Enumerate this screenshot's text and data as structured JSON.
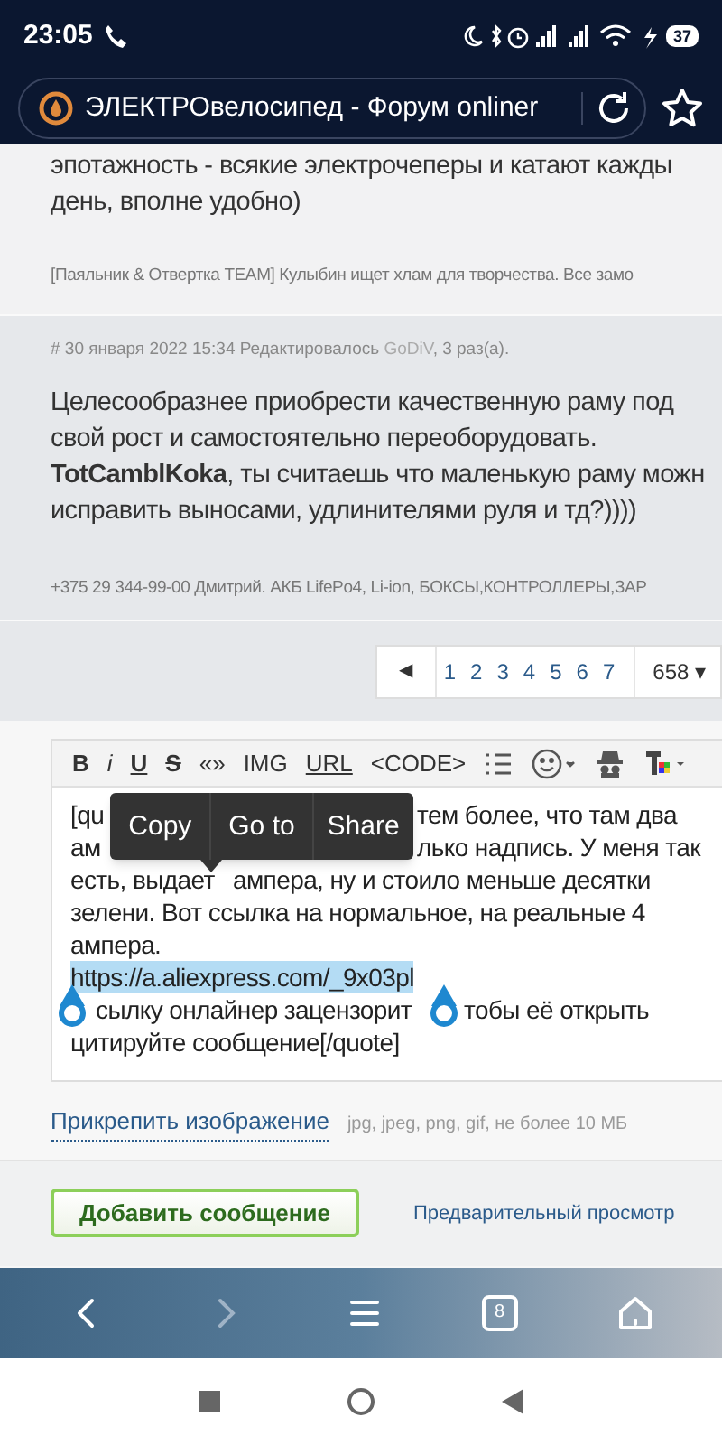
{
  "status_bar": {
    "time": "23:05",
    "battery": "37"
  },
  "address_bar": {
    "title": "ЭЛЕКТРОвелосипед - Форум onliner"
  },
  "previous_post": {
    "text_lines": [
      "эпотажность - всякие электрочеперы и катают кажды",
      "день, вполне удобно)"
    ],
    "signature": "[Паяльник & Отвертка TEAM] Кулыбин ищет хлам для творчества. Все замо"
  },
  "post": {
    "meta_prefix": "# 30 января 2022 15:34 Редактировалось ",
    "editor": "GoDiV",
    "meta_suffix": ", 3 раз(а).",
    "text_lines": [
      "Целесообразнее приобрести качественную раму под",
      "свой рост и самостоятельно переоборудовать.",
      "**TotCamblKoka**, ты считаешь что маленькую раму можн",
      "исправить выносами, удлинителями руля и тд?))))"
    ],
    "signature": "+375 29 344-99-00 Дмитрий. АКБ LifePo4, Li-ion, БОКСЫ,КОНТРОЛЛЕРЫ,ЗАР"
  },
  "pagination": {
    "prev": "◀",
    "pages": [
      "1",
      "2",
      "3",
      "4",
      "5",
      "6",
      "7"
    ],
    "last": "658 ▾"
  },
  "toolbar": [
    {
      "kind": "text",
      "label": "B"
    },
    {
      "kind": "text",
      "label": "i"
    },
    {
      "kind": "text",
      "label": "U"
    },
    {
      "kind": "text",
      "label": "S"
    },
    {
      "kind": "text",
      "label": "«»"
    },
    {
      "kind": "text",
      "label": "IMG"
    },
    {
      "kind": "text",
      "label": "URL"
    },
    {
      "kind": "text",
      "label": "<CODE>"
    },
    {
      "kind": "list"
    },
    {
      "kind": "smiley"
    },
    {
      "kind": "spy"
    },
    {
      "kind": "color"
    }
  ],
  "editor_lines": [
    {
      "parts": [
        "[qu",
        "тем более, что там два"
      ],
      "selected": false
    },
    {
      "parts": [
        "ам",
        "лько надпись. У меня так"
      ],
      "selected": false
    },
    {
      "parts": [
        "есть, выдает",
        "ампера, ну и стоило меньше десятки"
      ],
      "selected": false
    },
    {
      "parts": [
        "зелени.  Вот ссылка на нормальное, на реальные 4"
      ],
      "selected": false
    },
    {
      "parts": [
        "ампера."
      ],
      "selected": false
    },
    {
      "parts": [
        "https://a.aliexpress.com/_9x03pl"
      ],
      "selected": true
    },
    {
      "parts": [
        "сылку онлайнер зацензорит",
        "тобы её открыть"
      ],
      "selected": false
    },
    {
      "parts": [
        "цитируйте сообщение[/quote]"
      ],
      "selected": false
    }
  ],
  "context_menu": [
    "Copy",
    "Go to",
    "Share"
  ],
  "attach": {
    "link": "Прикрепить изображение",
    "hint": "jpg, jpeg, png, gif, не более 10 МБ"
  },
  "actions": {
    "submit": "Добавить сообщение",
    "preview": "Предварительный просмотр"
  },
  "browser_nav": {
    "tabs_count": "8"
  }
}
